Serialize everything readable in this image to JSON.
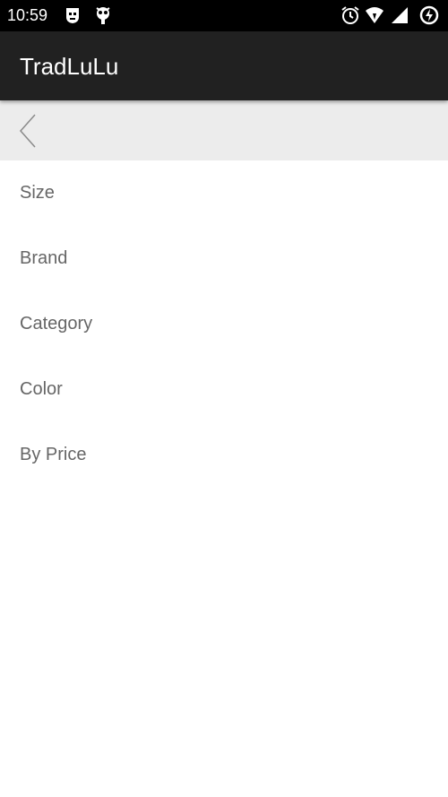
{
  "status_bar": {
    "time": "10:59",
    "icons": [
      "notification-icon",
      "bug-icon",
      "alarm-icon",
      "wifi-icon",
      "signal-icon",
      "battery-icon"
    ]
  },
  "app_bar": {
    "title": "TradLuLu"
  },
  "filter_header": {
    "back_icon": "chevron-left-icon"
  },
  "filters": {
    "items": [
      {
        "label": "Size"
      },
      {
        "label": "Brand"
      },
      {
        "label": "Category"
      },
      {
        "label": "Color"
      },
      {
        "label": "By Price"
      }
    ]
  },
  "colors": {
    "status_bar": "#000000",
    "app_bar": "#212121",
    "filter_header": "#ececec",
    "item_text": "#666666"
  }
}
